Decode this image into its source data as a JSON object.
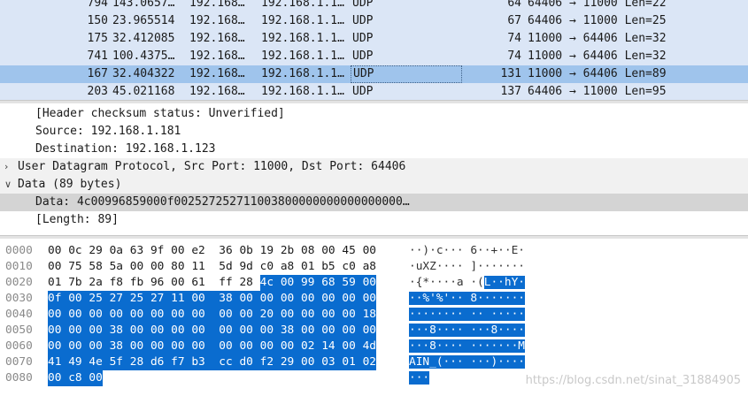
{
  "packet_list": {
    "rows": [
      {
        "no": "794",
        "time": "143.0657…",
        "src": "192.168…",
        "dst": "192.168.1.1…",
        "proto": "UDP",
        "len": "64",
        "info": "64406 → 11000 Len=22",
        "selected": false
      },
      {
        "no": "150",
        "time": "23.965514",
        "src": "192.168…",
        "dst": "192.168.1.1…",
        "proto": "UDP",
        "len": "67",
        "info": "64406 → 11000 Len=25",
        "selected": false
      },
      {
        "no": "175",
        "time": "32.412085",
        "src": "192.168…",
        "dst": "192.168.1.1…",
        "proto": "UDP",
        "len": "74",
        "info": "11000 → 64406 Len=32",
        "selected": false
      },
      {
        "no": "741",
        "time": "100.4375…",
        "src": "192.168…",
        "dst": "192.168.1.1…",
        "proto": "UDP",
        "len": "74",
        "info": "11000 → 64406 Len=32",
        "selected": false
      },
      {
        "no": "167",
        "time": "32.404322",
        "src": "192.168…",
        "dst": "192.168.1.1…",
        "proto": "UDP",
        "len": "131",
        "info": "11000 → 64406 Len=89",
        "selected": true
      },
      {
        "no": "203",
        "time": "45.021168",
        "src": "192.168…",
        "dst": "192.168.1.1…",
        "proto": "UDP",
        "len": "137",
        "info": "64406 → 11000 Len=95",
        "selected": false
      }
    ]
  },
  "details": {
    "rows": [
      {
        "text": "[Header checksum status: Unverified]",
        "arrow": "",
        "indent": 2,
        "kind": "leaf"
      },
      {
        "text": "Source: 192.168.1.181",
        "arrow": "",
        "indent": 2,
        "kind": "leaf"
      },
      {
        "text": "Destination: 192.168.1.123",
        "arrow": "",
        "indent": 2,
        "kind": "leaf"
      },
      {
        "text": "User Datagram Protocol, Src Port: 11000, Dst Port: 64406",
        "arrow": "›",
        "indent": 1,
        "kind": "expandable"
      },
      {
        "text": "Data (89 bytes)",
        "arrow": "∨",
        "indent": 1,
        "kind": "expandable"
      },
      {
        "text": "Data: 4c00996859000f002527252711003800000000000000000…",
        "arrow": "",
        "indent": 2,
        "kind": "selected"
      },
      {
        "text": "[Length: 89]",
        "arrow": "",
        "indent": 2,
        "kind": "leaf"
      }
    ]
  },
  "bytes": {
    "rows": [
      {
        "offset": "0000",
        "hex": [
          "00",
          "0c",
          "29",
          "0a",
          "63",
          "9f",
          "00",
          "e2",
          "36",
          "0b",
          "19",
          "2b",
          "08",
          "00",
          "45",
          "00"
        ],
        "ascii": "··)·c··· 6··+··E·",
        "hl_from": 16,
        "ascii_hl_from": 17
      },
      {
        "offset": "0010",
        "hex": [
          "00",
          "75",
          "58",
          "5a",
          "00",
          "00",
          "80",
          "11",
          "5d",
          "9d",
          "c0",
          "a8",
          "01",
          "b5",
          "c0",
          "a8"
        ],
        "ascii": "·uXZ···· ]·······",
        "hl_from": 16,
        "ascii_hl_from": 17
      },
      {
        "offset": "0020",
        "hex": [
          "01",
          "7b",
          "2a",
          "f8",
          "fb",
          "96",
          "00",
          "61",
          "ff",
          "28",
          "4c",
          "00",
          "99",
          "68",
          "59",
          "00"
        ],
        "ascii": "·{*····a ·(L··hY·",
        "hl_from": 10,
        "ascii_hl_from": 11
      },
      {
        "offset": "0030",
        "hex": [
          "0f",
          "00",
          "25",
          "27",
          "25",
          "27",
          "11",
          "00",
          "38",
          "00",
          "00",
          "00",
          "00",
          "00",
          "00",
          "00"
        ],
        "ascii": "··%'%'·· 8·······",
        "hl_from": 0,
        "ascii_hl_from": 0
      },
      {
        "offset": "0040",
        "hex": [
          "00",
          "00",
          "00",
          "00",
          "00",
          "00",
          "00",
          "00",
          "00",
          "00",
          "20",
          "00",
          "00",
          "00",
          "00",
          "18"
        ],
        "ascii": "········ ·· ·····",
        "hl_from": 0,
        "ascii_hl_from": 0
      },
      {
        "offset": "0050",
        "hex": [
          "00",
          "00",
          "00",
          "38",
          "00",
          "00",
          "00",
          "00",
          "00",
          "00",
          "00",
          "38",
          "00",
          "00",
          "00",
          "00"
        ],
        "ascii": "···8···· ···8····",
        "hl_from": 0,
        "ascii_hl_from": 0
      },
      {
        "offset": "0060",
        "hex": [
          "00",
          "00",
          "00",
          "38",
          "00",
          "00",
          "00",
          "00",
          "00",
          "00",
          "00",
          "00",
          "02",
          "14",
          "00",
          "4d"
        ],
        "ascii": "···8···· ·······M",
        "hl_from": 0,
        "ascii_hl_from": 0
      },
      {
        "offset": "0070",
        "hex": [
          "41",
          "49",
          "4e",
          "5f",
          "28",
          "d6",
          "f7",
          "b3",
          "cc",
          "d0",
          "f2",
          "29",
          "00",
          "03",
          "01",
          "02"
        ],
        "ascii": "AIN_(··· ···)····",
        "hl_from": 0,
        "ascii_hl_from": 0
      },
      {
        "offset": "0080",
        "hex": [
          "00",
          "c8",
          "00"
        ],
        "ascii": "···",
        "hl_from": 0,
        "ascii_hl_from": 0
      }
    ]
  },
  "watermark": "https://blog.csdn.net/sinat_31884905",
  "colors": {
    "selected_packet": "#9fc4ec",
    "bytes_highlight": "#0a6ccf",
    "details_selected": "#d4d4d4"
  }
}
